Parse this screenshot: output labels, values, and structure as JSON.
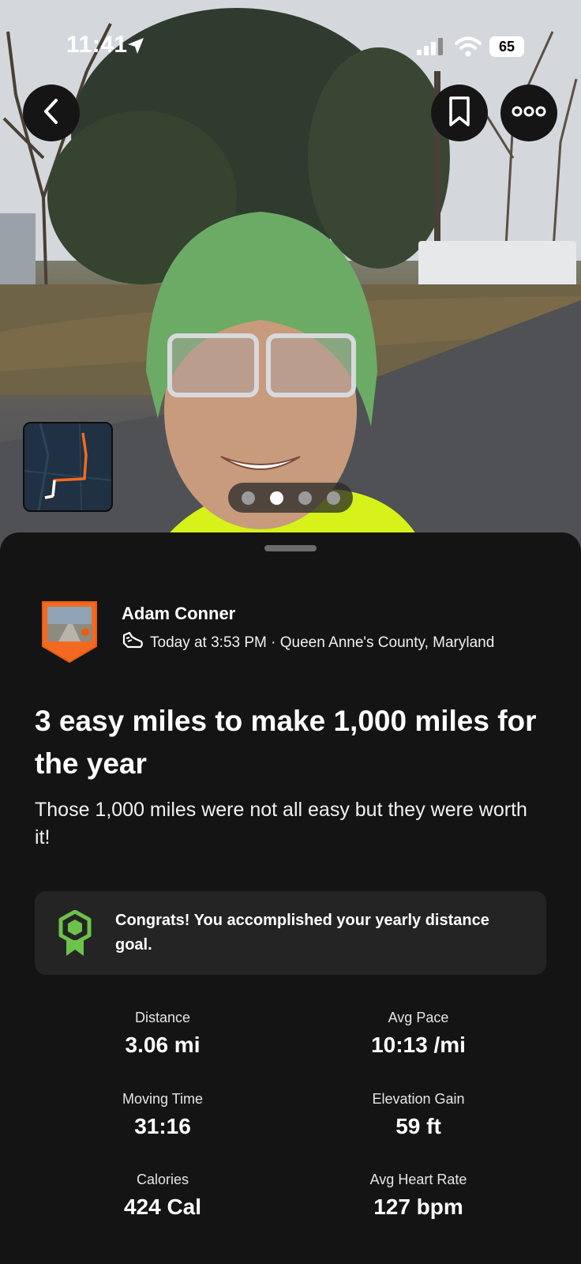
{
  "status_bar": {
    "time": "11:41",
    "battery": "65"
  },
  "header": {
    "back_icon": "chevron-left-icon",
    "save_icon": "bookmark-icon",
    "more_icon": "ellipsis-icon"
  },
  "carousel": {
    "page_count": 4,
    "active_index": 1
  },
  "athlete": {
    "name": "Adam Conner",
    "meta": "Today at 3:53 PM · Queen Anne's County, Maryland",
    "activity_icon": "running-shoe-icon"
  },
  "activity": {
    "title": "3 easy miles to make 1,000 miles for the year",
    "description": "Those 1,000 miles were not all easy but they were worth it!"
  },
  "goal": {
    "icon": "badge-icon",
    "text": "Congrats! You accomplished your yearly distance goal.",
    "accent_color": "#6cc24a"
  },
  "stats": [
    {
      "label": "Distance",
      "value": "3.06 mi"
    },
    {
      "label": "Avg Pace",
      "value": "10:13 /mi"
    },
    {
      "label": "Moving Time",
      "value": "31:16"
    },
    {
      "label": "Elevation Gain",
      "value": "59 ft"
    },
    {
      "label": "Calories",
      "value": "424 Cal"
    },
    {
      "label": "Avg Heart Rate",
      "value": "127 bpm"
    }
  ],
  "colors": {
    "route": "#f26a21",
    "background": "#141414",
    "card": "#242424"
  }
}
